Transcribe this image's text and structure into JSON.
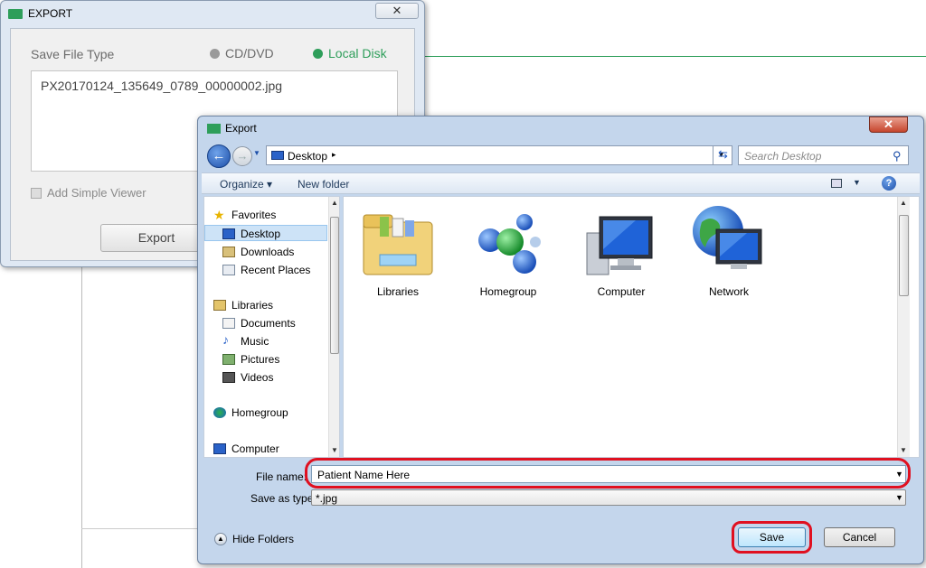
{
  "export_window": {
    "title": "EXPORT",
    "close_glyph": "✕",
    "save_file_type_label": "Save File Type",
    "options": [
      {
        "label": "CD/DVD",
        "selected": false
      },
      {
        "label": "Local Disk",
        "selected": true
      }
    ],
    "filename": "PX20170124_135649_0789_00000002.jpg",
    "add_simple_viewer_label": "Add Simple Viewer",
    "add_simple_viewer_checked": false,
    "export_button": "Export",
    "accent_color": "#2e9e5a"
  },
  "save_dialog": {
    "title": "Export",
    "close_glyph": "✕",
    "address": {
      "location": "Desktop",
      "separator": "▸"
    },
    "search_placeholder": "Search Desktop",
    "toolbar": {
      "organize": "Organize ▾",
      "new_folder": "New folder"
    },
    "nav": {
      "favorites": "Favorites",
      "favorite_items": [
        "Desktop",
        "Downloads",
        "Recent Places"
      ],
      "libraries": "Libraries",
      "library_items": [
        "Documents",
        "Music",
        "Pictures",
        "Videos"
      ],
      "homegroup": "Homegroup",
      "computer": "Computer",
      "selected": "Desktop"
    },
    "items": [
      {
        "label": "Libraries",
        "icon": "library-folder-icon"
      },
      {
        "label": "Homegroup",
        "icon": "homegroup-icon"
      },
      {
        "label": "Computer",
        "icon": "computer-icon"
      },
      {
        "label": "Network",
        "icon": "network-icon"
      }
    ],
    "file_name_label": "File name:",
    "file_name_value": "Patient Name Here",
    "save_as_type_label": "Save as type:",
    "save_as_type_value": "*.jpg",
    "hide_folders": "Hide Folders",
    "save_button": "Save",
    "cancel_button": "Cancel",
    "highlight_color": "#e01020"
  }
}
